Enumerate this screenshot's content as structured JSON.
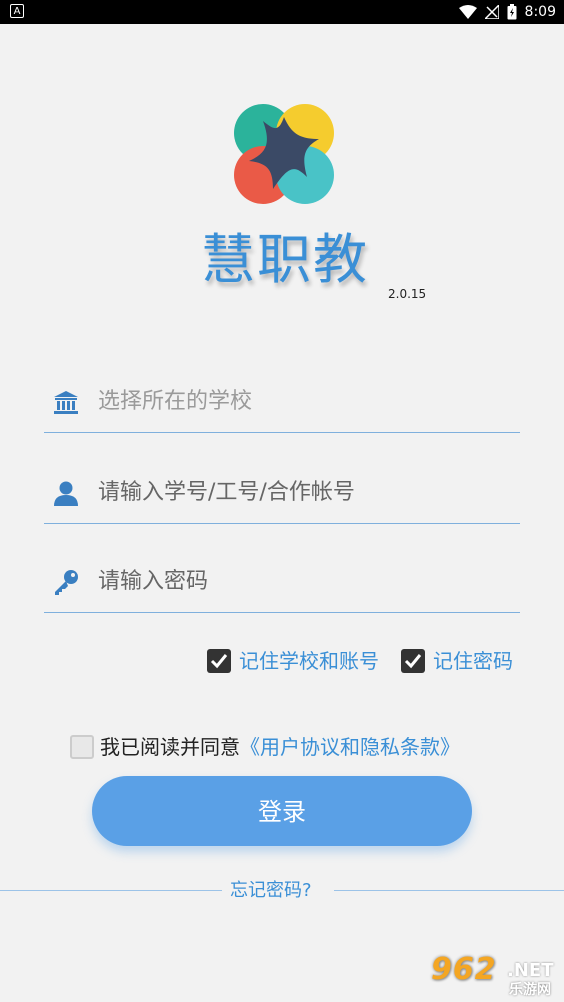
{
  "status_bar": {
    "left_icon_label": "A",
    "time": "8:09",
    "icons": [
      "wifi-icon",
      "signal-icon",
      "battery-icon"
    ]
  },
  "app": {
    "name": "慧职教",
    "version": "2.0.15"
  },
  "form": {
    "school_placeholder": "选择所在的学校",
    "account_placeholder": "请输入学号/工号/合作帐号",
    "password_placeholder": "请输入密码",
    "remember_school_label": "记住学校和账号",
    "remember_school_checked": true,
    "remember_password_label": "记住密码",
    "remember_password_checked": true
  },
  "agreement": {
    "checked": false,
    "prefix": "我已阅读并同意",
    "link": "《用户协议和隐私条款》"
  },
  "login_button_label": "登录",
  "forgot_password": "忘记密码?",
  "watermark": {
    "number": "962",
    "domain": ".NET",
    "text": "乐游网"
  },
  "colors": {
    "accent": "#3a8fd6",
    "button": "#5aa0e6",
    "background": "#f2f2f2",
    "logo_teal": "#2bb39b",
    "logo_yellow": "#f5cc2e",
    "logo_red": "#ea5a47",
    "logo_cyan": "#49c3c7",
    "logo_center": "#3b4a66"
  }
}
